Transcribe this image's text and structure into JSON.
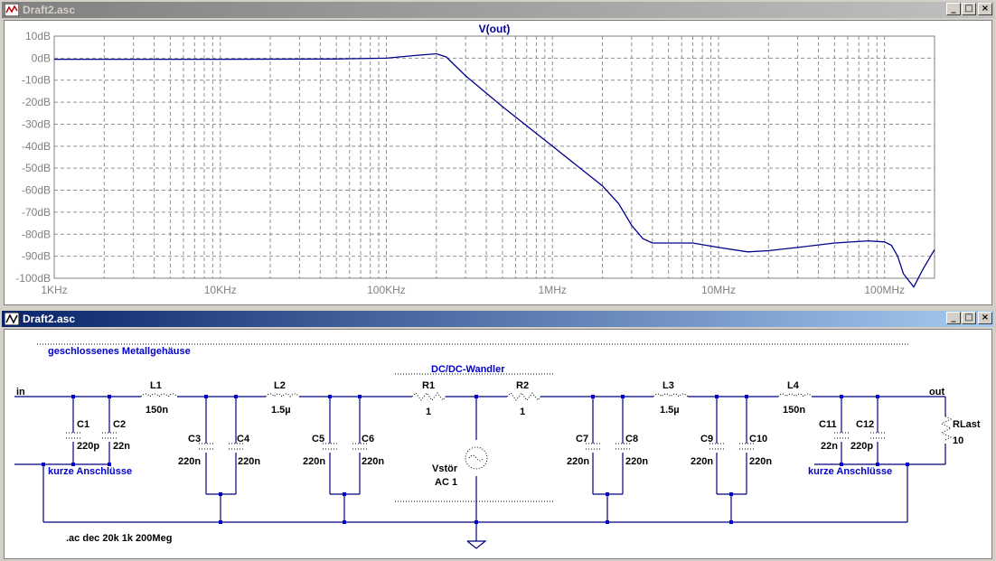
{
  "plot_window": {
    "title": "Draft2.asc",
    "minimize_glyph": "_",
    "maximize_glyph": "□",
    "close_glyph": "×",
    "icon": "waveform-icon"
  },
  "schematic_window": {
    "title": "Draft2.asc",
    "minimize_glyph": "_",
    "maximize_glyph": "□",
    "close_glyph": "×",
    "icon": "schematic-icon"
  },
  "chart_data": {
    "type": "line",
    "title": "V(out)",
    "xlabel": "",
    "ylabel": "",
    "x_scale": "log",
    "xlim_hz": [
      1000,
      200000000
    ],
    "ylim_db": [
      -100,
      10
    ],
    "x_tick_labels": [
      "1KHz",
      "10KHz",
      "100KHz",
      "1MHz",
      "10MHz",
      "100MHz"
    ],
    "y_tick_labels": [
      "10dB",
      "0dB",
      "-10dB",
      "-20dB",
      "-30dB",
      "-40dB",
      "-50dB",
      "-60dB",
      "-70dB",
      "-80dB",
      "-90dB",
      "-100dB"
    ],
    "grid": true,
    "line_color": "#00008b",
    "series": [
      {
        "x": [
          1000,
          10000,
          50000,
          100000,
          150000,
          200000,
          230000,
          300000,
          500000,
          1000000,
          2000000,
          2500000,
          3000000,
          3500000,
          4000000,
          5000000,
          7000000,
          10000000,
          15000000,
          20000000,
          30000000,
          50000000,
          80000000,
          100000000,
          110000000,
          120000000,
          130000000,
          150000000,
          170000000,
          200000000
        ],
        "y": [
          -0.5,
          -0.5,
          -0.4,
          0,
          1.2,
          2,
          0.5,
          -8,
          -22,
          -40,
          -58,
          -66,
          -76,
          -82,
          -84,
          -84,
          -84,
          -86,
          -88,
          -87.5,
          -86,
          -84,
          -83,
          -83.5,
          -85,
          -90,
          -98,
          -104,
          -96,
          -87
        ]
      }
    ]
  },
  "schematic": {
    "labels": {
      "enclosure": "geschlossenes Metallgehäuse",
      "converter": "DC/DC-Wandler",
      "net_in": "in",
      "net_out": "out",
      "short_left": "kurze Anschlüsse",
      "short_right": "kurze Anschlüsse",
      "directive": ".ac dec 20k 1k 200Meg"
    },
    "components": {
      "L1": {
        "ref": "L1",
        "value": "150n"
      },
      "L2": {
        "ref": "L2",
        "value": "1.5µ"
      },
      "R1": {
        "ref": "R1",
        "value": "1"
      },
      "R2": {
        "ref": "R2",
        "value": "1"
      },
      "L3": {
        "ref": "L3",
        "value": "1.5µ"
      },
      "L4": {
        "ref": "L4",
        "value": "150n"
      },
      "C1": {
        "ref": "C1",
        "value": "220p"
      },
      "C2": {
        "ref": "C2",
        "value": "22n"
      },
      "C3": {
        "ref": "C3",
        "value": "220n"
      },
      "C4": {
        "ref": "C4",
        "value": "220n"
      },
      "C5": {
        "ref": "C5",
        "value": "220n"
      },
      "C6": {
        "ref": "C6",
        "value": "220n"
      },
      "C7": {
        "ref": "C7",
        "value": "220n"
      },
      "C8": {
        "ref": "C8",
        "value": "220n"
      },
      "C9": {
        "ref": "C9",
        "value": "220n"
      },
      "C10": {
        "ref": "C10",
        "value": "220n"
      },
      "C11": {
        "ref": "C11",
        "value": "22n"
      },
      "C12": {
        "ref": "C12",
        "value": "220p"
      },
      "Vstor": {
        "ref": "Vstör",
        "value": "AC 1"
      },
      "RLast": {
        "ref": "RLast",
        "value": "10"
      }
    }
  }
}
